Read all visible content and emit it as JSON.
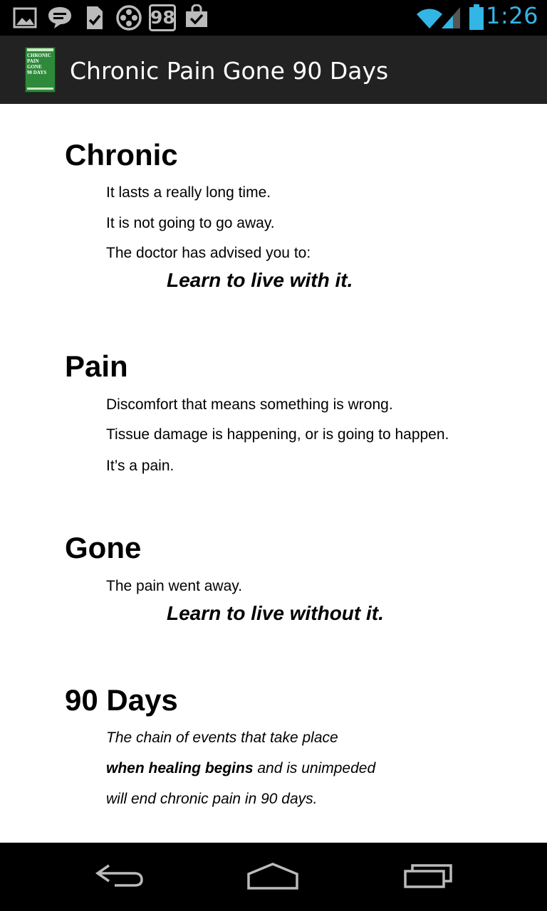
{
  "status_bar": {
    "time": "1:26",
    "notification_count": "98",
    "left_icons": [
      "gallery-icon",
      "chat-icon",
      "document-check-icon",
      "film-reel-icon",
      "counter-badge-icon",
      "shopping-bag-check-icon"
    ],
    "right_icons": [
      "wifi-icon",
      "signal-icon",
      "battery-icon"
    ],
    "accent_color": "#33b5e5"
  },
  "action_bar": {
    "title": "Chronic Pain Gone 90 Days",
    "app_icon_lines": [
      "CHRONIC",
      "PAIN",
      "GONE",
      "90 DAYS"
    ],
    "app_icon_color": "#2e8a3a",
    "background": "#222222"
  },
  "sections": [
    {
      "heading": "Chronic",
      "lines": [
        "It lasts a really long time.",
        "It is not going to go away.",
        "The doctor has advised you to:"
      ],
      "emphasis": "Learn to live with it."
    },
    {
      "heading": "Pain",
      "lines": [
        "Discomfort that means something is wrong.",
        "Tissue damage is happening, or is going to happen.",
        "It’s a pain."
      ]
    },
    {
      "heading": "Gone",
      "lines": [
        "The pain went away."
      ],
      "emphasis": "Learn to live without it."
    },
    {
      "heading": "90 Days",
      "lines": [
        {
          "text": "The chain of events that take place"
        },
        {
          "bold": "when healing begins",
          "text": " and is unimpeded"
        },
        {
          "text": "will end chronic pain in 90 days."
        }
      ]
    }
  ],
  "nav_bar": {
    "buttons": [
      "back-icon",
      "home-icon",
      "recent-apps-icon"
    ]
  }
}
